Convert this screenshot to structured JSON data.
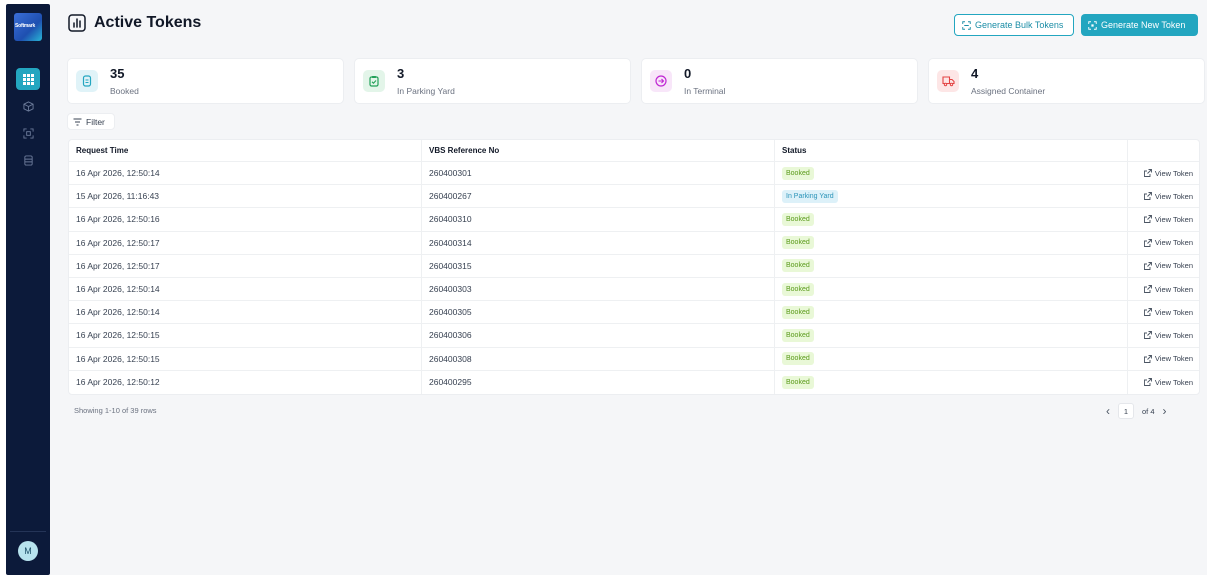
{
  "sidebar": {
    "logo_text": "Softmark",
    "nav_icons": [
      "grid-icon",
      "cube-icon",
      "scan-icon",
      "database-icon"
    ],
    "avatar_initial": "M"
  },
  "header": {
    "title": "Active Tokens",
    "bulk_button": "Generate Bulk Tokens",
    "new_button": "Generate New Token"
  },
  "stats": [
    {
      "value": "35",
      "label": "Booked",
      "icon": "document-icon",
      "color": "#23a6c0",
      "bg": "#e0f3f8"
    },
    {
      "value": "3",
      "label": "In Parking Yard",
      "icon": "clipboard-check-icon",
      "color": "#22a058",
      "bg": "#e3f5e9"
    },
    {
      "value": "0",
      "label": "In Terminal",
      "icon": "arrow-circle-icon",
      "color": "#c026d3",
      "bg": "#f8e6f9"
    },
    {
      "value": "4",
      "label": "Assigned Container",
      "icon": "truck-icon",
      "color": "#e34343",
      "bg": "#fde6e6"
    }
  ],
  "filter_label": "Filter",
  "table": {
    "columns": [
      "Request Time",
      "VBS Reference No",
      "Status"
    ],
    "action_label": "View Token",
    "rows": [
      {
        "time": "16 Apr 2026, 12:50:14",
        "ref": "260400301",
        "status": "Booked"
      },
      {
        "time": "15 Apr 2026, 11:16:43",
        "ref": "260400267",
        "status": "In Parking Yard"
      },
      {
        "time": "16 Apr 2026, 12:50:16",
        "ref": "260400310",
        "status": "Booked"
      },
      {
        "time": "16 Apr 2026, 12:50:17",
        "ref": "260400314",
        "status": "Booked"
      },
      {
        "time": "16 Apr 2026, 12:50:17",
        "ref": "260400315",
        "status": "Booked"
      },
      {
        "time": "16 Apr 2026, 12:50:14",
        "ref": "260400303",
        "status": "Booked"
      },
      {
        "time": "16 Apr 2026, 12:50:14",
        "ref": "260400305",
        "status": "Booked"
      },
      {
        "time": "16 Apr 2026, 12:50:15",
        "ref": "260400306",
        "status": "Booked"
      },
      {
        "time": "16 Apr 2026, 12:50:15",
        "ref": "260400308",
        "status": "Booked"
      },
      {
        "time": "16 Apr 2026, 12:50:12",
        "ref": "260400295",
        "status": "Booked"
      }
    ]
  },
  "footer": {
    "showing": "Showing 1-10 of 39 rows",
    "page": "1",
    "of_pages": "of 4"
  }
}
